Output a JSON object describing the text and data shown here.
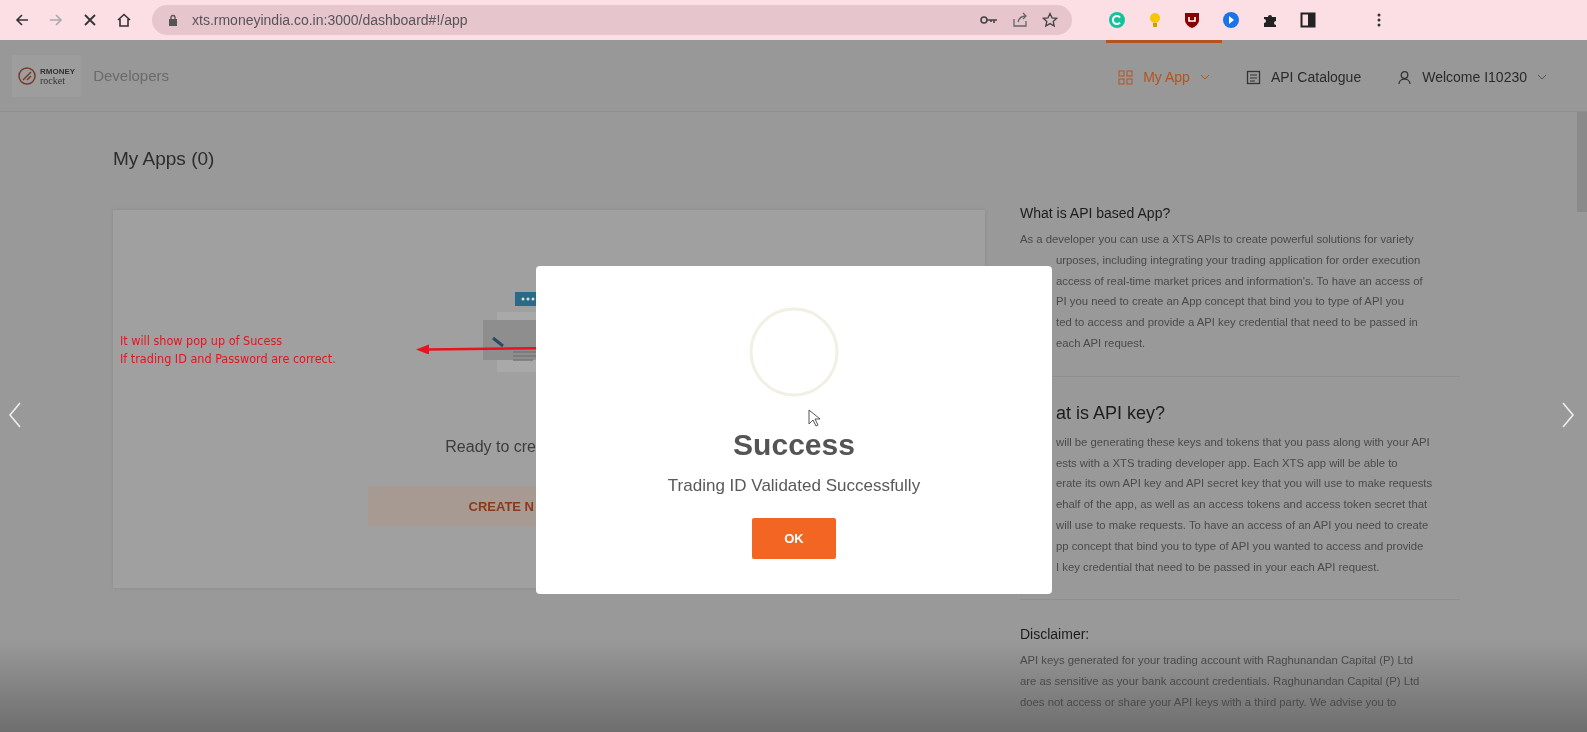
{
  "browser": {
    "url": "xts.rmoneyindia.co.in:3000/dashboard#!/app",
    "forward_disabled": true
  },
  "header": {
    "logo_top": "RMONEY",
    "logo_bottom": "rocket",
    "brand": "Developers",
    "nav": [
      {
        "kind": "grid",
        "label": "My App",
        "selected": true,
        "dropdown": true
      },
      {
        "kind": "doc",
        "label": "API Catalogue",
        "selected": false,
        "dropdown": false
      },
      {
        "kind": "user",
        "label": "Welcome I10230",
        "selected": false,
        "dropdown": true
      }
    ]
  },
  "page_title": "My Apps (0)",
  "card": {
    "ready_text": "Ready to cre",
    "create_button": "CREATE N"
  },
  "annotation": {
    "lines": [
      "It will show pop up of Sucess",
      "If trading ID and Password are correct."
    ]
  },
  "info": [
    {
      "heading": "What is API based App?",
      "lines": [
        {
          "text": "As a developer you can use a XTS APIs to create powerful solutions for variety"
        },
        {
          "text": "urposes, including integrating your trading application for order execution",
          "partly_hidden": true
        },
        {
          "text": "access of real-time market prices and information's. To have an access of",
          "partly_hidden": true
        },
        {
          "text": "PI you need to create an App concept that bind you to type of API you",
          "partly_hidden": true
        },
        {
          "text": "ted to access and provide a API key credential that need to be passed in",
          "partly_hidden": true
        },
        {
          "text": "each API request.",
          "partly_hidden": true
        }
      ]
    },
    {
      "heading": "at is API key?",
      "heading_partly_hidden": true,
      "lines": [
        {
          "text": "will be generating these keys and tokens that you pass along with your API",
          "partly_hidden": true
        },
        {
          "text": "ests with a XTS trading developer app. Each XTS app will be able to",
          "partly_hidden": true
        },
        {
          "text": "erate its own API key and API secret key that you will use to make requests",
          "partly_hidden": true
        },
        {
          "text": "ehalf of the app, as well as an access tokens and access token secret that",
          "partly_hidden": true
        },
        {
          "text": "will use to make requests. To have an access of an API you need to create",
          "partly_hidden": true
        },
        {
          "text": "pp concept that bind you to type of API you wanted to access and provide",
          "partly_hidden": true
        },
        {
          "text": "I key credential that need to be passed in your each API request.",
          "partly_hidden": true
        }
      ]
    },
    {
      "heading": "Disclaimer:",
      "lines": [
        {
          "text": "API keys generated for your trading account with Raghunandan Capital (P) Ltd"
        },
        {
          "text": "are as sensitive as your bank account credentials. Raghunandan Capital (P) Ltd"
        },
        {
          "text": "does not access or share your API keys with a third party. We advise you to"
        }
      ]
    }
  ],
  "dialog": {
    "title": "Success",
    "message": "Trading ID Validated Successfully",
    "button": "OK"
  }
}
